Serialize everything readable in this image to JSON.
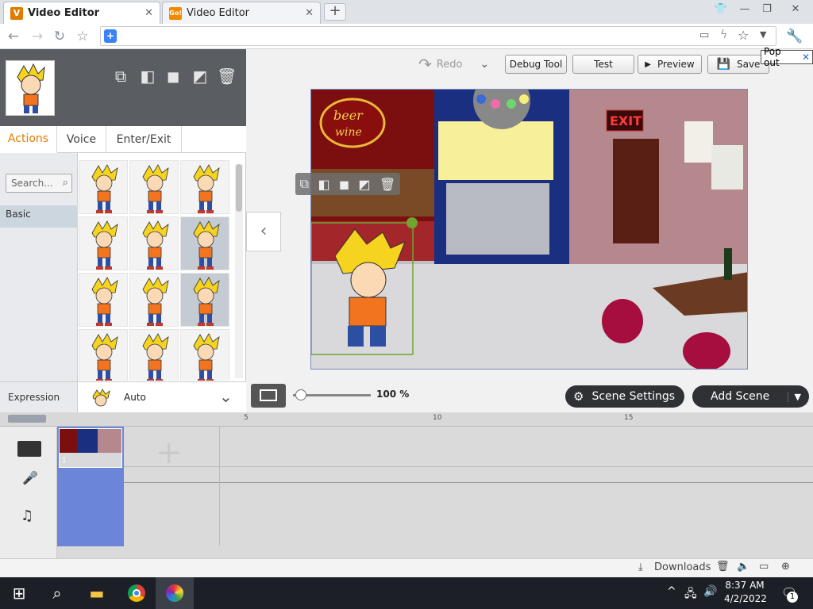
{
  "browser": {
    "tabs": [
      {
        "label": "Video Editor",
        "favicon": "V",
        "active": true
      },
      {
        "label": "Video Editor",
        "favicon": "Go!",
        "active": false
      }
    ],
    "new_tab_symbol": "+",
    "window_controls": [
      "minimize-icon",
      "maximize-icon",
      "close-icon"
    ]
  },
  "toolbar": {
    "redo_label": "Redo",
    "debug_label": "Debug Tool",
    "test_label": "Test",
    "preview_label": "Preview",
    "save_label": "Save",
    "popout_label": "Pop out"
  },
  "panel": {
    "tabs": [
      "Actions",
      "Voice",
      "Enter/Exit"
    ],
    "active_tab": "Actions",
    "search_placeholder": "Search...",
    "category": "Basic",
    "expression_label": "Expression",
    "expression_value": "Auto"
  },
  "stage_controls": {
    "zoom": "100 %",
    "zoom_level": 0.1,
    "scene_settings_label": "Scene Settings",
    "add_scene_label": "Add Scene"
  },
  "timeline": {
    "ruler_ticks": [
      "5",
      "10",
      "15"
    ],
    "scene_number": "1"
  },
  "statusbar": {
    "downloads_label": "Downloads"
  },
  "taskbar": {
    "time": "8:37 AM",
    "date": "4/2/2022",
    "notification_count": "1"
  },
  "colors": {
    "accent_orange": "#e07b00",
    "scene_blue": "#6b85d8",
    "pill_dark": "#2f3135"
  }
}
